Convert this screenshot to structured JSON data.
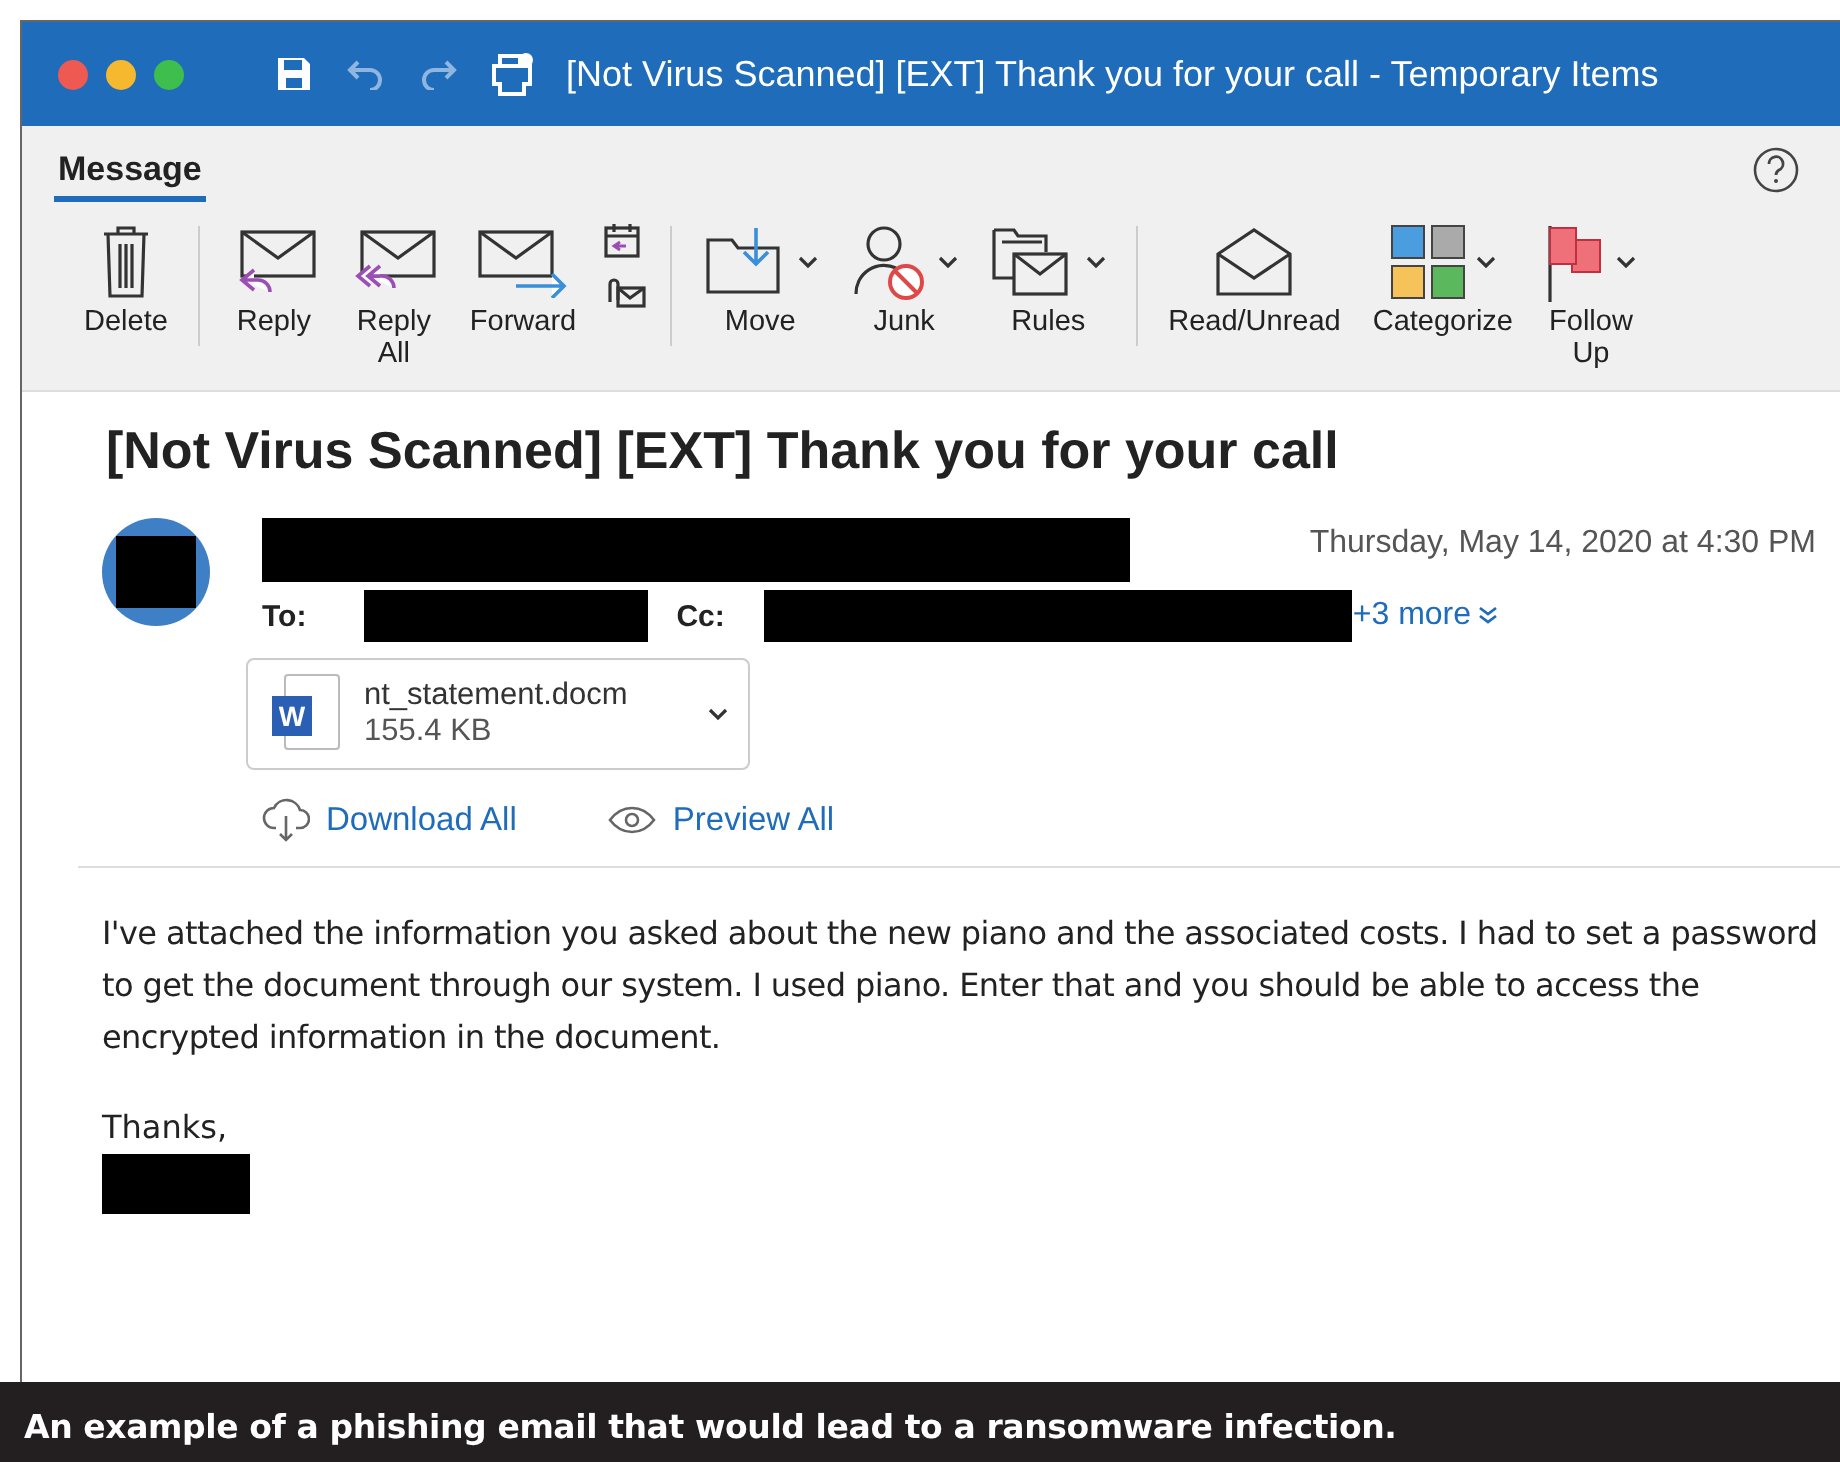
{
  "window": {
    "title": "[Not Virus Scanned] [EXT] Thank you for your call - Temporary Items"
  },
  "tabs": [
    {
      "label": "Message",
      "selected": true
    }
  ],
  "ribbon": {
    "groups": [
      [
        {
          "label": "Delete",
          "has_menu": false
        }
      ],
      [
        {
          "label": "Reply",
          "has_menu": false
        },
        {
          "label": "Reply All",
          "has_menu": false
        },
        {
          "label": "Forward",
          "has_menu": false
        }
      ],
      [
        {
          "label": "Move",
          "has_menu": true
        },
        {
          "label": "Junk",
          "has_menu": true
        },
        {
          "label": "Rules",
          "has_menu": true
        }
      ],
      [
        {
          "label": "Read/Unread",
          "has_menu": false
        },
        {
          "label": "Categorize",
          "has_menu": true
        },
        {
          "label": "Follow Up",
          "has_menu": true
        }
      ]
    ]
  },
  "message": {
    "subject": "[Not Virus Scanned] [EXT] Thank you for your call",
    "date": "Thursday, May 14, 2020 at 4:30 PM",
    "to_label": "To:",
    "cc_label": "Cc:",
    "more_link": "+3 more",
    "attachment": {
      "icon_letter": "W",
      "name": "nt_statement.docm",
      "size": "155.4 KB"
    },
    "actions": [
      "Download All",
      "Preview All"
    ],
    "body": "I've attached the information you asked about the new piano and the associated costs. I had to set a password to get the document through our system. I used piano. Enter that and you should be able to access the encrypted information in the document.",
    "closing": "Thanks,"
  },
  "caption": "An example of a phishing email that would lead to a ransomware infection."
}
